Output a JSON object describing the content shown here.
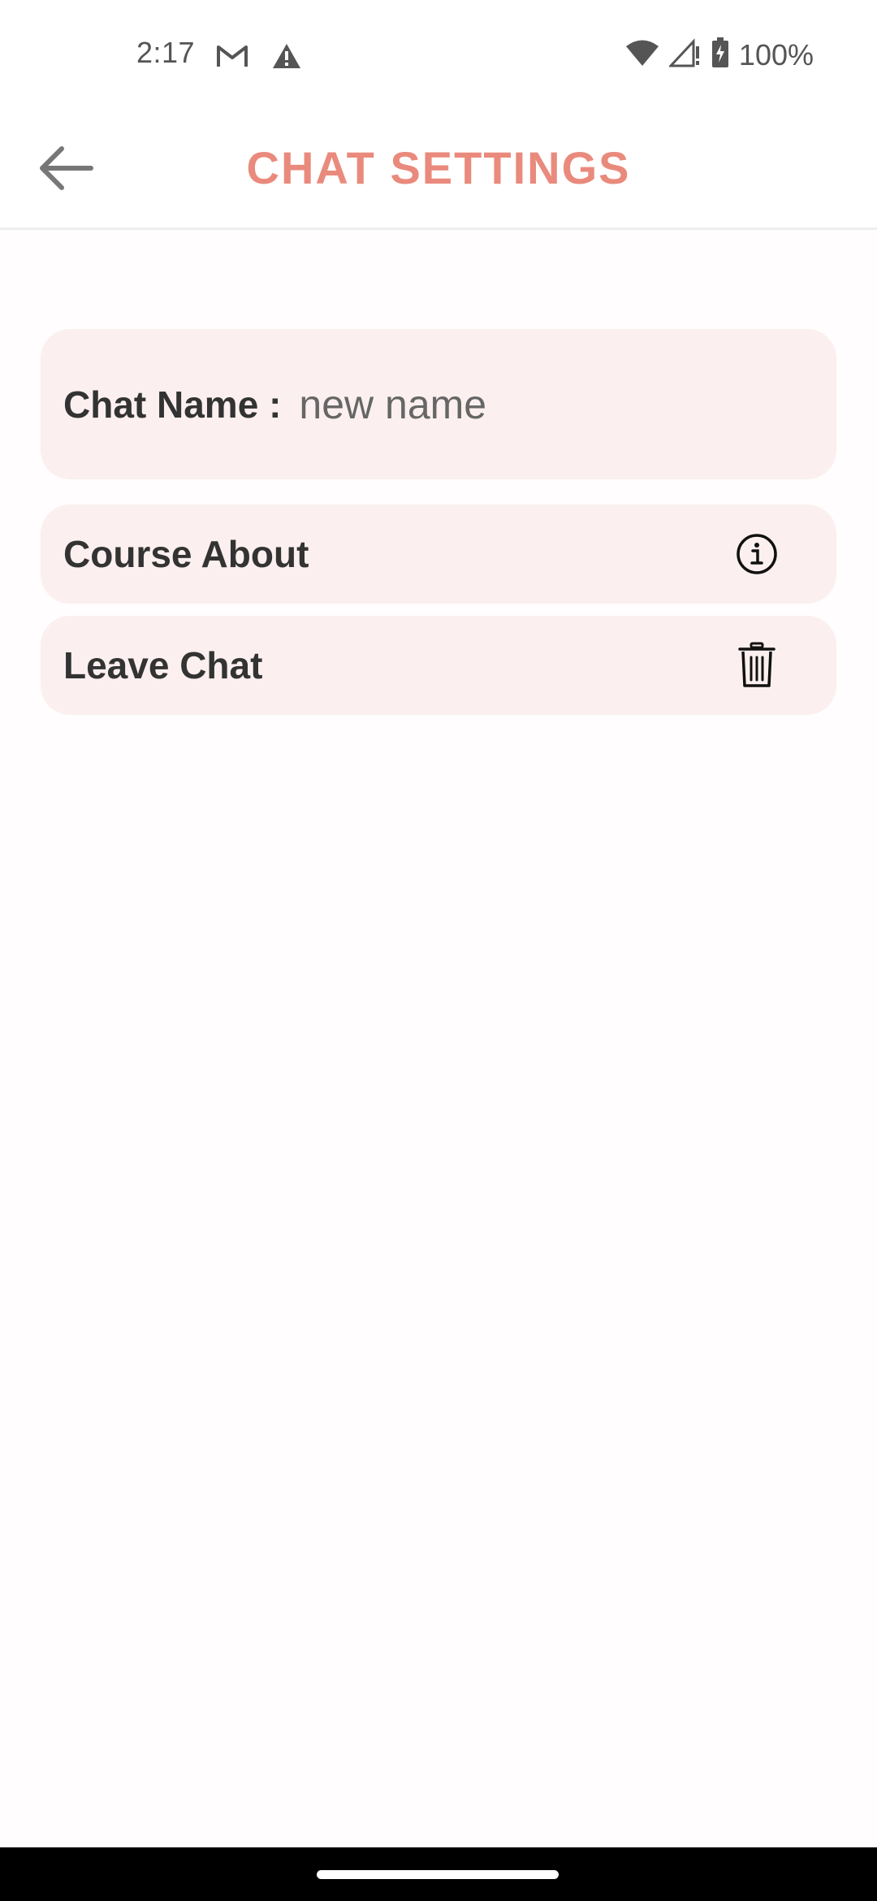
{
  "status_bar": {
    "time": "2:17",
    "battery": "100%",
    "icons": [
      "gmail-icon",
      "warning-icon",
      "wifi-icon",
      "signal-icon",
      "battery-charging-icon"
    ]
  },
  "header": {
    "title": "CHAT SETTINGS",
    "back_icon": "arrow-left-icon",
    "title_color": "#e98a7d"
  },
  "chat_name": {
    "label": "Chat Name :",
    "value": "new name",
    "placeholder": ""
  },
  "items": [
    {
      "label": "Course About",
      "icon": "info-icon"
    },
    {
      "label": "Leave Chat",
      "icon": "trash-icon"
    }
  ],
  "colors": {
    "card_background": "#fbf0ef",
    "text": "#333333"
  }
}
